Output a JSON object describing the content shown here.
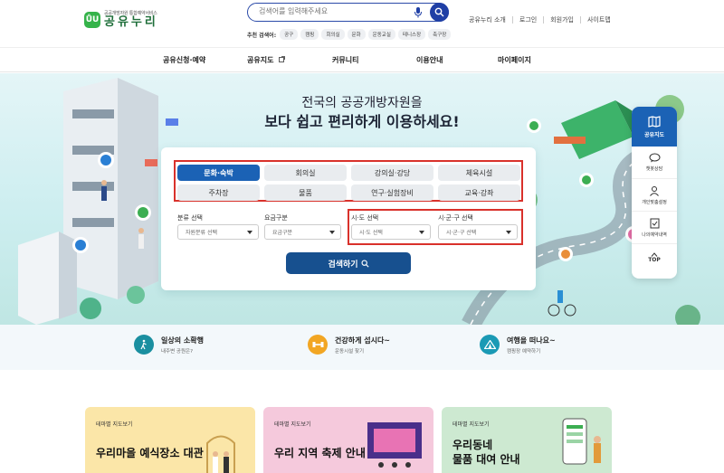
{
  "header": {
    "logo_mark": "ŮU",
    "logo_sub": "공공개방자원 통합예약서비스",
    "logo_main": "공유누리",
    "search_placeholder": "검색어를 입력해주세요",
    "recommend_label": "추천 검색어:",
    "recommend_tags": [
      "공구",
      "캠핑",
      "회의실",
      "문화",
      "운동교실",
      "테니스장",
      "축구장"
    ],
    "util_links": [
      "공유누리 소개",
      "로그인",
      "회원가입",
      "사이트맵"
    ]
  },
  "nav": {
    "items": [
      "공유신청·예약",
      "공유지도",
      "커뮤니티",
      "이용안내",
      "마이페이지"
    ]
  },
  "hero": {
    "title_line1": "전국의 공공개방자원을",
    "title_line2": "보다 쉽고 편리하게 이용하세요!"
  },
  "search_panel": {
    "categories": [
      "문화·숙박",
      "회의실",
      "강의실·강당",
      "체육시설",
      "주차장",
      "물품",
      "연구·실험장비",
      "교육·강좌"
    ],
    "active_category": "문화·숙박",
    "filters": [
      {
        "label": "분류 선택",
        "value": "자원분류 선택"
      },
      {
        "label": "요금구분",
        "value": "요금구분"
      },
      {
        "label": "시·도 선택",
        "value": "시·도 선택"
      },
      {
        "label": "시·군·구 선택",
        "value": "시·군·구 선택"
      }
    ],
    "search_button": "검색하기"
  },
  "quick_menu": {
    "top": "공유지도",
    "items": [
      "챗봇상담",
      "개인맞춤설정",
      "나의예약내역"
    ],
    "top_button": "TOP"
  },
  "features": [
    {
      "title": "일상의 소확행",
      "sub": "내주변 공원은?",
      "icon": "walking-icon",
      "color": "#1a8fa0"
    },
    {
      "title": "건강하게 섭시다~",
      "sub": "운동시설 찾기",
      "icon": "dumbbell-icon",
      "color": "#f2a623"
    },
    {
      "title": "여행을 떠나요~",
      "sub": "캠핑장 예약하기",
      "icon": "tent-icon",
      "color": "#1b9ab5"
    }
  ],
  "theme_cards": [
    {
      "tag": "테마별 지도보기",
      "title": "우리마을 예식장소 대관",
      "bg": "#fbe6a8"
    },
    {
      "tag": "테마별 지도보기",
      "title": "우리 지역 축제 안내",
      "bg": "#f5c9dc"
    },
    {
      "tag": "테마별 지도보기",
      "title_line1": "우리동네",
      "title_line2": "물품 대여 안내",
      "bg": "#cde9d1"
    }
  ]
}
